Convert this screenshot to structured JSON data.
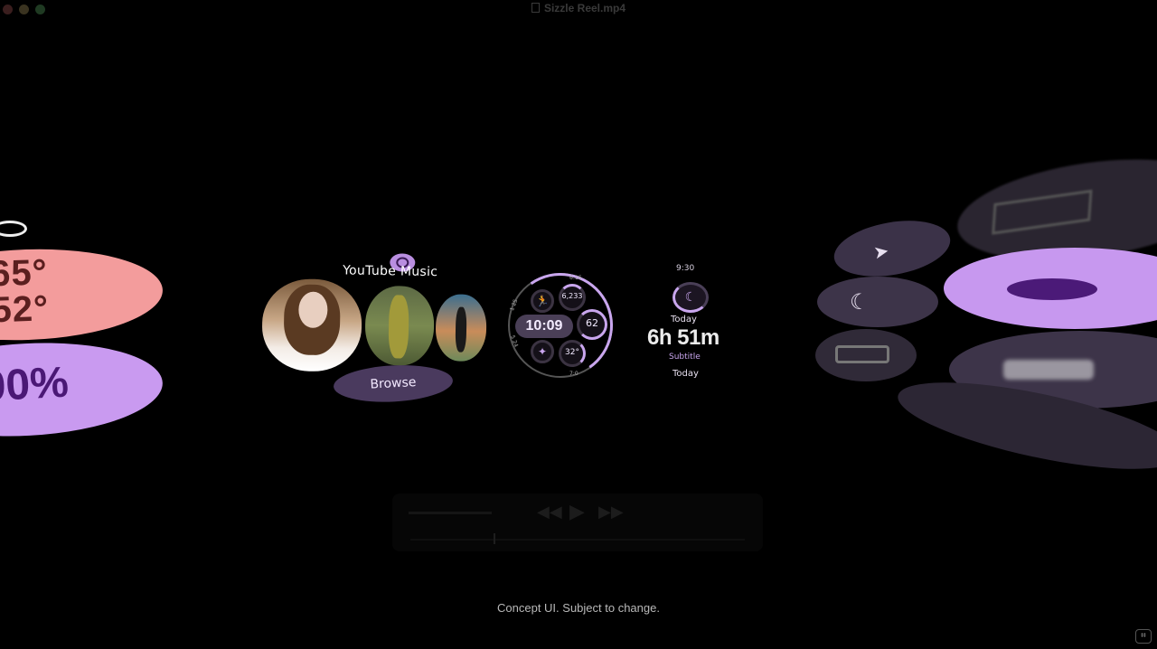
{
  "window": {
    "title": "Sizzle Reel.mp4"
  },
  "left_tiles": {
    "temp_high": "65°",
    "temp_low": "52°",
    "percent": "00%"
  },
  "youtube_music": {
    "title": "YouTube Music",
    "browse_label": "Browse"
  },
  "watch_face": {
    "time": "10:09",
    "steps": "6,233",
    "heart_rate": "62",
    "temperature": "32°",
    "label_top": "6:16",
    "label_left": "1 25",
    "label_bottom": "5 24",
    "label_btm_right": "7:0"
  },
  "sleep_tile": {
    "time": "9:30",
    "day_label": "Today",
    "duration": "6h 51m",
    "subtitle": "Subtitle",
    "footer": "Today"
  },
  "caption": "Concept UI. Subject to change.",
  "colors": {
    "accent_purple": "#c99af0",
    "accent_pink": "#f39c9c",
    "dark_purple": "#4a3a5e"
  }
}
